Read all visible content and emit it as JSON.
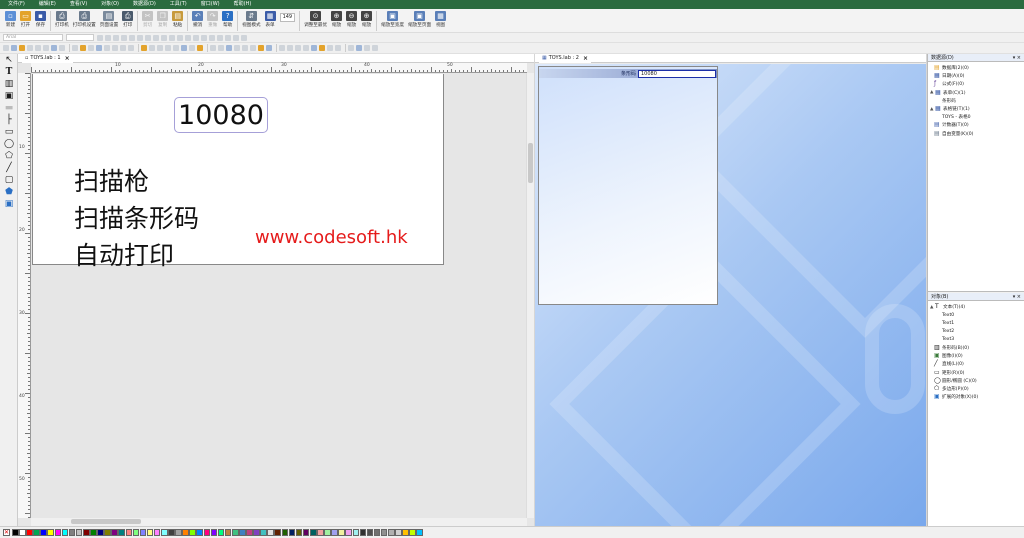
{
  "menu": [
    "文件(F)",
    "编辑(E)",
    "查看(V)",
    "对象(O)",
    "数据源(D)",
    "工具(T)",
    "窗口(W)",
    "帮助(H)"
  ],
  "toolbar": [
    {
      "label": "新建",
      "icon": "new-file-icon",
      "color": "#5b8fd6"
    },
    {
      "label": "打开",
      "icon": "open-folder-icon",
      "color": "#e3a32c"
    },
    {
      "label": "保存",
      "icon": "save-icon",
      "color": "#3a5ba8"
    },
    {
      "label": "打印机",
      "icon": "printer-icon",
      "color": "#6a7a8c"
    },
    {
      "label": "打印机设置",
      "icon": "printer-settings-icon",
      "color": "#6a7a8c"
    },
    {
      "label": "页面设置",
      "icon": "page-setup-icon",
      "color": "#7a8a9c"
    },
    {
      "label": "打印",
      "icon": "print-icon",
      "color": "#4a5a6c"
    },
    {
      "label": "剪切",
      "icon": "cut-icon",
      "color": "#8a8a8a",
      "disabled": true
    },
    {
      "label": "复制",
      "icon": "copy-icon",
      "color": "#8a8a8a",
      "disabled": true
    },
    {
      "label": "粘贴",
      "icon": "paste-icon",
      "color": "#c79a3c"
    },
    {
      "label": "撤消",
      "icon": "undo-icon",
      "color": "#5a7fb8"
    },
    {
      "label": "重做",
      "icon": "redo-icon",
      "color": "#8a8a8a",
      "disabled": true
    },
    {
      "label": "帮助",
      "icon": "help-icon",
      "color": "#2a6fc4"
    },
    {
      "label": "视图模式",
      "icon": "view-mode-icon",
      "color": "#6a7a8c"
    },
    {
      "label": "表单",
      "icon": "form-icon",
      "color": "#3a5ba8"
    },
    {
      "label": "调整至最优",
      "icon": "zoom-fit-icon",
      "color": "#444"
    },
    {
      "label": "缩放",
      "icon": "zoom-in-icon",
      "color": "#444"
    },
    {
      "label": "缩放",
      "icon": "zoom-out-icon",
      "color": "#444"
    },
    {
      "label": "缩放",
      "icon": "zoom-icon",
      "color": "#444"
    },
    {
      "label": "缩放至宽度",
      "icon": "zoom-width-icon",
      "color": "#5a7fb8"
    },
    {
      "label": "缩放至页面",
      "icon": "zoom-page-icon",
      "color": "#5a7fb8"
    },
    {
      "label": "视图",
      "icon": "view-icon",
      "color": "#5a7fb8"
    }
  ],
  "zoom_value": "149",
  "font_placeholder": "Arial",
  "doc1": {
    "tab": "TOYS.lab : 1",
    "ruler_h": [
      "10",
      "20",
      "30",
      "40",
      "50"
    ],
    "ruler_v": [
      "10",
      "20",
      "30",
      "40",
      "50",
      "60",
      "70",
      "80",
      "90"
    ],
    "barcode_value": "10080",
    "lines": [
      "扫描枪",
      "扫描条形码",
      "自动打印"
    ],
    "url": "www.codesoft.hk"
  },
  "doc2": {
    "tab": "TOYS.lab : 2",
    "form_label": "条形码",
    "form_value": "10080"
  },
  "datasource_panel": {
    "title": "数据源(D)",
    "items": [
      {
        "label": "数据库(2)(0)",
        "icon": "database-icon",
        "indent": 1,
        "toggle": ""
      },
      {
        "label": "日期(A)(0)",
        "icon": "date-icon",
        "indent": 1,
        "toggle": ""
      },
      {
        "label": "公式(F)(0)",
        "icon": "formula-icon",
        "indent": 1,
        "toggle": ""
      },
      {
        "label": "表单(C)(1)",
        "icon": "form-icon",
        "indent": 0,
        "toggle": "▲"
      },
      {
        "label": "条形码",
        "icon": "",
        "indent": 3,
        "toggle": ""
      },
      {
        "label": "表格链(T)(1)",
        "icon": "table-link-icon",
        "indent": 0,
        "toggle": "▲"
      },
      {
        "label": "TOYS - 表格0",
        "icon": "",
        "indent": 3,
        "toggle": ""
      },
      {
        "label": "计数器(T)(0)",
        "icon": "counter-icon",
        "indent": 1,
        "toggle": ""
      },
      {
        "label": "自由变量(K)(0)",
        "icon": "free-variable-icon",
        "indent": 1,
        "toggle": ""
      }
    ]
  },
  "objects_panel": {
    "title": "对象(B)",
    "items": [
      {
        "label": "文本(T)(4)",
        "icon": "text-icon",
        "indent": 0,
        "toggle": "▲"
      },
      {
        "label": "Text0",
        "icon": "",
        "indent": 3,
        "toggle": ""
      },
      {
        "label": "Text1",
        "icon": "",
        "indent": 3,
        "toggle": ""
      },
      {
        "label": "Text2",
        "icon": "",
        "indent": 3,
        "toggle": ""
      },
      {
        "label": "Text3",
        "icon": "",
        "indent": 3,
        "toggle": ""
      },
      {
        "label": "条形码(B)(0)",
        "icon": "barcode-icon",
        "indent": 1,
        "toggle": ""
      },
      {
        "label": "图像(I)(0)",
        "icon": "image-icon",
        "indent": 1,
        "toggle": ""
      },
      {
        "label": "直线(L)(0)",
        "icon": "line-icon",
        "indent": 1,
        "toggle": ""
      },
      {
        "label": "矩形(R)(0)",
        "icon": "rectangle-icon",
        "indent": 1,
        "toggle": ""
      },
      {
        "label": "圆形/椭圆 (C)(0)",
        "icon": "ellipse-icon",
        "indent": 1,
        "toggle": ""
      },
      {
        "label": "多边形(P)(0)",
        "icon": "polygon-icon",
        "indent": 1,
        "toggle": ""
      },
      {
        "label": "扩展的对象(X)(0)",
        "icon": "extended-object-icon",
        "indent": 1,
        "toggle": ""
      }
    ]
  },
  "palette": [
    "#000000",
    "#ffffff",
    "#ff0000",
    "#00a651",
    "#0000ff",
    "#ffff00",
    "#ff00ff",
    "#00ffff",
    "#808080",
    "#c0c0c0",
    "#800000",
    "#008000",
    "#000080",
    "#808000",
    "#800080",
    "#008080",
    "#ff8080",
    "#80ff80",
    "#8080ff",
    "#ffff80",
    "#ff80ff",
    "#80ffff",
    "#404040",
    "#a0a0a0",
    "#ff8000",
    "#80ff00",
    "#0080ff",
    "#ff0080",
    "#8000ff",
    "#00ff80",
    "#c08040",
    "#40c080",
    "#4080c0",
    "#c04080",
    "#8040c0",
    "#40c0c0",
    "#e0e0e0",
    "#602000",
    "#206000",
    "#002060",
    "#606000",
    "#600060",
    "#006060",
    "#f0a0a0",
    "#a0f0a0",
    "#a0a0f0",
    "#f0f0a0",
    "#f0a0f0",
    "#a0f0f0",
    "#303030",
    "#505050",
    "#707070",
    "#909090",
    "#b0b0b0",
    "#d0d0d0",
    "#ffc000",
    "#c0ff00",
    "#00c0ff"
  ]
}
